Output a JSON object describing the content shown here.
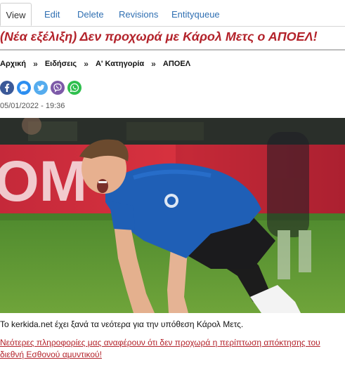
{
  "tabs": [
    {
      "label": "View"
    },
    {
      "label": "Edit"
    },
    {
      "label": "Delete"
    },
    {
      "label": "Revisions"
    },
    {
      "label": "Entityqueue"
    }
  ],
  "article": {
    "title": "(Νέα εξέλιξη) Δεν προχωρά με Κάρολ Μετς ο ΑΠΟΕΛ!",
    "breadcrumb": [
      "Αρχική",
      "Ειδήσεις",
      "Α' Κατηγορία",
      "ΑΠΟΕΛ"
    ],
    "breadcrumb_sep": "»",
    "date": "05/01/2022 - 19:36",
    "lead": "Το kerkida.net έχει ξανά τα νεότερα για την υπόθεση Κάρολ Μετς.",
    "link_text": "Νεότερες πληροφορίες μας αναφέρουν ότι δεν προχωρά η περίπτωση απόκτησης του διεθνή Εσθονού αμυντικού!"
  },
  "share": [
    {
      "icon": "facebook-icon",
      "color": "#3b5998"
    },
    {
      "icon": "messenger-icon",
      "color": "#2c8ef0"
    },
    {
      "icon": "twitter-icon",
      "color": "#55acee"
    },
    {
      "icon": "viber-icon",
      "color": "#7d5aa8"
    },
    {
      "icon": "whatsapp-icon",
      "color": "#2fbf4e"
    }
  ],
  "colors": {
    "accent": "#b3232b",
    "tab_link": "#2f6fb2"
  }
}
